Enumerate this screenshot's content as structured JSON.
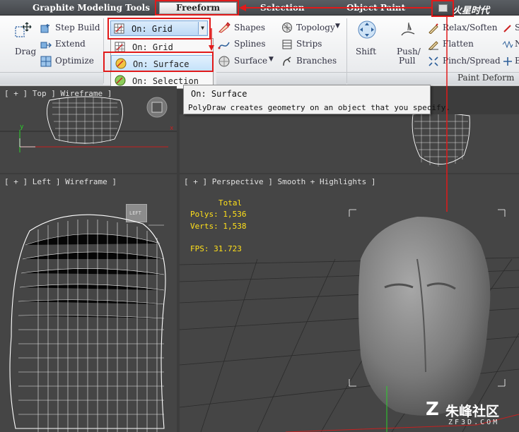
{
  "ribbon_tabs": {
    "graphite": "Graphite Modeling Tools",
    "freeform": "Freeform",
    "selection": "Selection",
    "object_paint": "Object Paint"
  },
  "tools": {
    "drag": "Drag",
    "step_build": "Step Build",
    "extend": "Extend",
    "optimize": "Optimize",
    "shapes": "Shapes",
    "splines": "Splines",
    "surface": "Surface",
    "topology": "Topology",
    "strips": "Strips",
    "branches": "Branches",
    "shift": "Shift",
    "push": "Push/",
    "pull": "Pull",
    "relax": "Relax/Soften",
    "flatten": "Flatten",
    "pinch": "Pinch/Spread"
  },
  "panels": {
    "paint_deform": "Paint Deform"
  },
  "dropdown": {
    "current": "On: Grid",
    "items": [
      "On: Grid",
      "On: Surface",
      "On: Selection"
    ]
  },
  "tooltip": {
    "title": "On: Surface",
    "description": "PolyDraw creates geometry on an object that you specify."
  },
  "viewports": {
    "top": "[ + ] Top ] Wireframe ]",
    "left": "[ + ] Left ] Wireframe ]",
    "perspective": "[ + ] Perspective ] Smooth + Highlights ]"
  },
  "view_cube": {
    "left_face": "LEFT"
  },
  "stats": {
    "total_label": "Total",
    "polys": "Polys: 1,536",
    "verts": "Verts: 1,538",
    "fps": "FPS:   31.723"
  },
  "axes": {
    "x": "x",
    "y": "y"
  },
  "watermark": {
    "text": "朱峰社区",
    "site": "ZF3D.COM",
    "logo": "火星时代"
  },
  "colors": {
    "highlight": "#e11a1a",
    "stats_text": "#ffe01a",
    "viewport_bg": "#454545",
    "wire": "#ffffff"
  }
}
